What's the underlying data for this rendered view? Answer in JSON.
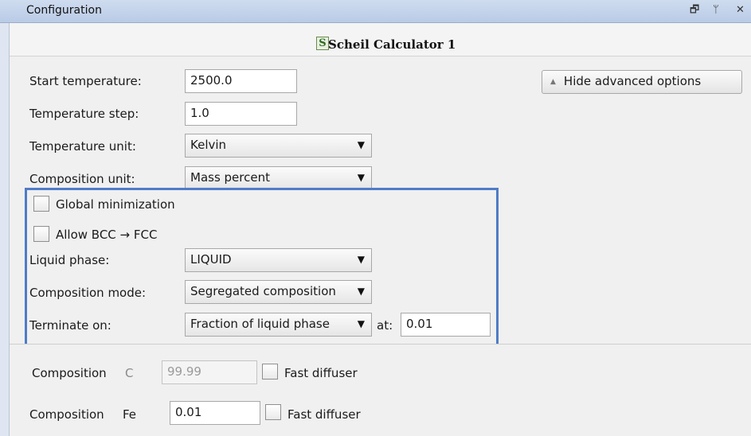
{
  "window": {
    "title": "Configuration",
    "controls": {
      "restore_icon": "restore-icon",
      "pin_icon": "pin-icon",
      "close_icon": "close-icon",
      "restore_glyph": "🗗",
      "pin_glyph": "ᛘ",
      "close_glyph": "✕"
    }
  },
  "header": {
    "icon_letter": "S",
    "calculator_title": "Scheil Calculator 1"
  },
  "form": {
    "start_temperature": {
      "label": "Start temperature:",
      "value": "2500.0"
    },
    "temperature_step": {
      "label": "Temperature step:",
      "value": "1.0"
    },
    "temperature_unit": {
      "label": "Temperature unit:",
      "selected": "Kelvin"
    },
    "composition_unit": {
      "label": "Composition unit:",
      "selected": "Mass percent"
    },
    "advanced_button": {
      "label": "Hide advanced options"
    }
  },
  "advanced": {
    "global_minimization": {
      "label": "Global minimization",
      "checked": false
    },
    "allow_bcc_fcc": {
      "label": "Allow BCC → FCC",
      "checked": false
    },
    "liquid_phase": {
      "label": "Liquid phase:",
      "selected": "LIQUID"
    },
    "composition_mode": {
      "label": "Composition mode:",
      "selected": "Segregated composition"
    },
    "terminate_on": {
      "label": "Terminate on:",
      "selected": "Fraction of liquid phase",
      "at_label": "at:",
      "at_value": "0.01"
    }
  },
  "compositions": [
    {
      "label": "Composition",
      "element": "C",
      "value": "99.99",
      "disabled": true,
      "fast_diffuser_label": "Fast diffuser",
      "fast_diffuser": false
    },
    {
      "label": "Composition",
      "element": "Fe",
      "value": "0.01",
      "disabled": false,
      "fast_diffuser_label": "Fast diffuser",
      "fast_diffuser": false
    }
  ],
  "colors": {
    "highlight_border": "#4f7cc6",
    "titlebar": "#c4d4ec",
    "panel": "#f0f0f0"
  }
}
